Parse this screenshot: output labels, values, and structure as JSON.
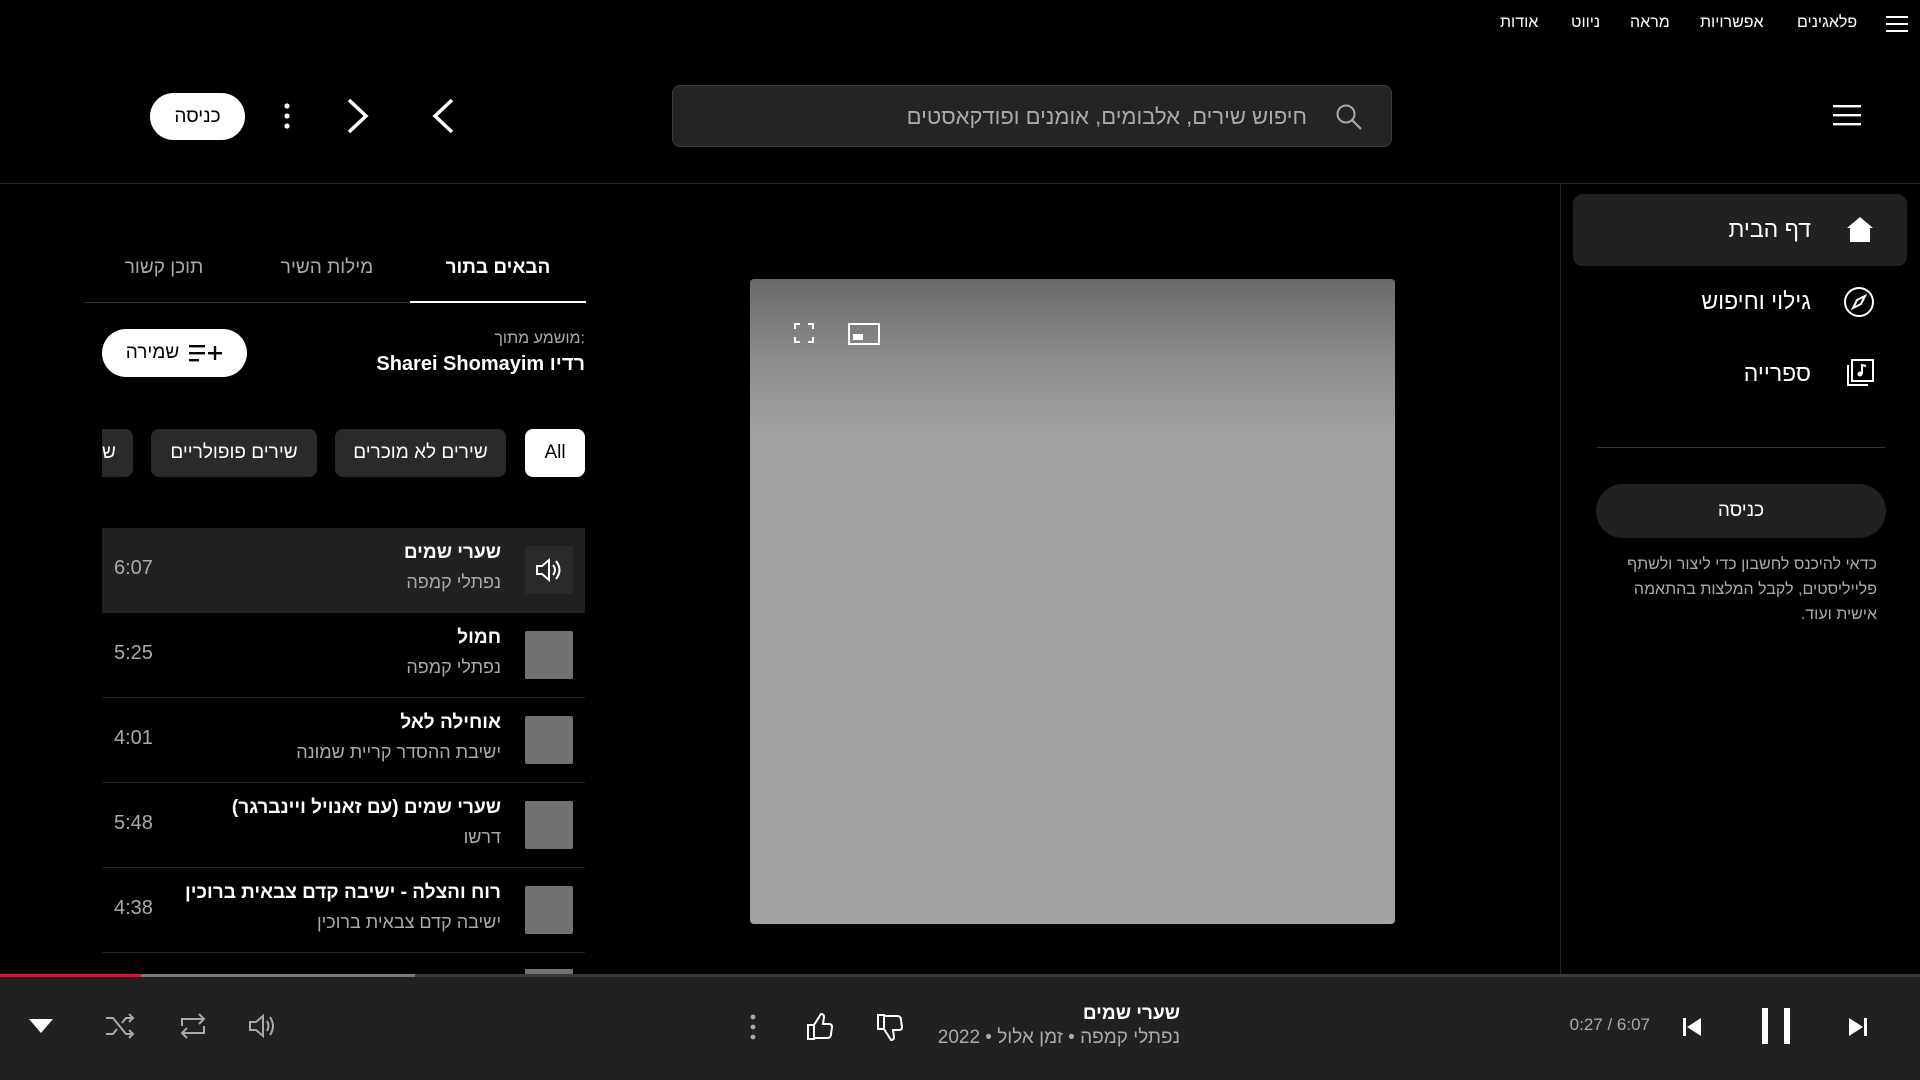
{
  "menubar": {
    "items": [
      "פלאגינים",
      "אפשרויות",
      "מראה",
      "ניווט",
      "אודות"
    ]
  },
  "header": {
    "search_placeholder": "חיפוש שירים, אלבומים, אומנים ופודקאסטים",
    "login_label": "כניסה"
  },
  "sidebar": {
    "items": [
      {
        "label": "דף הבית",
        "icon": "home-icon",
        "active": true
      },
      {
        "label": "גילוי וחיפוש",
        "icon": "compass-icon",
        "active": false
      },
      {
        "label": "ספרייה",
        "icon": "library-icon",
        "active": false
      }
    ],
    "login_label": "כניסה",
    "hint": "כדאי להיכנס לחשבון כדי ליצור ולשתף פלייליסטים, לקבל המלצות בהתאמה אישית ועוד."
  },
  "queue": {
    "tabs": [
      "הבאים בתור",
      "מילות השיר",
      "תוכן קשור"
    ],
    "source_label": "מושמע מתוך:",
    "source_name": "רדיו Sharei Shomayim",
    "save_label": "שמירה",
    "chips": [
      "All",
      "שירים לא מוכרים",
      "שירים פופולריים",
      "ש"
    ],
    "items": [
      {
        "title": "שערי שמים",
        "artist": "נפתלי קמפה",
        "duration": "6:07",
        "playing": true
      },
      {
        "title": "חמול",
        "artist": "נפתלי קמפה",
        "duration": "5:25",
        "playing": false
      },
      {
        "title": "אוחילה לאל",
        "artist": "ישיבת ההסדר קריית שמונה",
        "duration": "4:01",
        "playing": false
      },
      {
        "title": "שערי שמים (עם זאנויל ויינברגר)",
        "artist": "דרשו",
        "duration": "5:48",
        "playing": false
      },
      {
        "title": "רוח והצלה - ישיבה קדם צבאית ברוכין",
        "artist": "ישיבה קדם צבאית ברוכין",
        "duration": "4:38",
        "playing": false
      }
    ]
  },
  "player": {
    "title": "שערי שמים",
    "subtitle": "נפתלי קמפה • זמן אלול • 2022",
    "time": "0:27 / 6:07",
    "progress_fraction": 0.0736,
    "buffer_fraction": 0.2163,
    "accent_color": "#ff0033"
  }
}
